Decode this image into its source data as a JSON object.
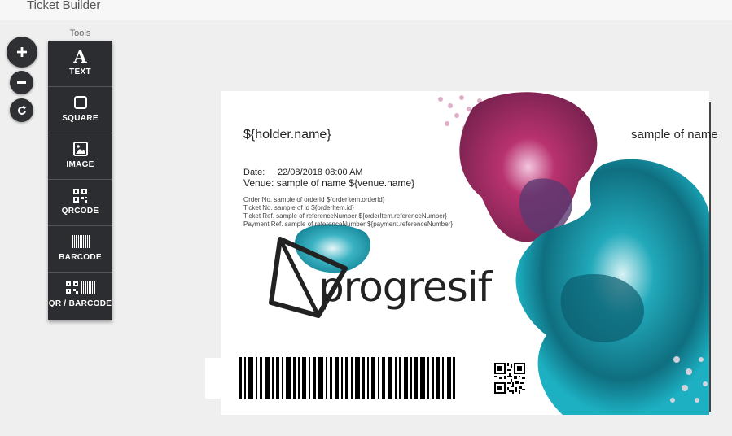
{
  "app": {
    "title": "Ticket Builder"
  },
  "zoom": {
    "in_label": "+",
    "out_label": "−"
  },
  "tools": {
    "label": "Tools",
    "items": [
      {
        "label": "TEXT",
        "icon": "text-icon"
      },
      {
        "label": "SQUARE",
        "icon": "square-icon"
      },
      {
        "label": "IMAGE",
        "icon": "image-icon"
      },
      {
        "label": "QRCODE",
        "icon": "qrcode-icon"
      },
      {
        "label": "BARCODE",
        "icon": "barcode-icon"
      },
      {
        "label": "QR / BARCODE",
        "icon": "qr-barcode-icon"
      }
    ]
  },
  "ticket": {
    "holder_name": "${holder.name}",
    "sample_name": "sample of name",
    "date_label": "Date:",
    "date_value": "22/08/2018 08:00 AM",
    "venue": "Venue: sample of name ${venue.name}",
    "order_no": "Order No.   sample of orderId ${orderItem.orderId}",
    "ticket_no": "Ticket No.   sample of id ${orderItem.id}",
    "ticket_ref": "Ticket Ref.   sample of referenceNumber ${orderItem.referenceNumber}",
    "payment_ref": "Payment Ref.   sample of referenceNumber ${payment.referenceNumber}",
    "logo_text": "progresif"
  },
  "colors": {
    "magenta": "#c43a7e",
    "teal": "#1aa3b3",
    "toolbox": "#2c2d30"
  }
}
